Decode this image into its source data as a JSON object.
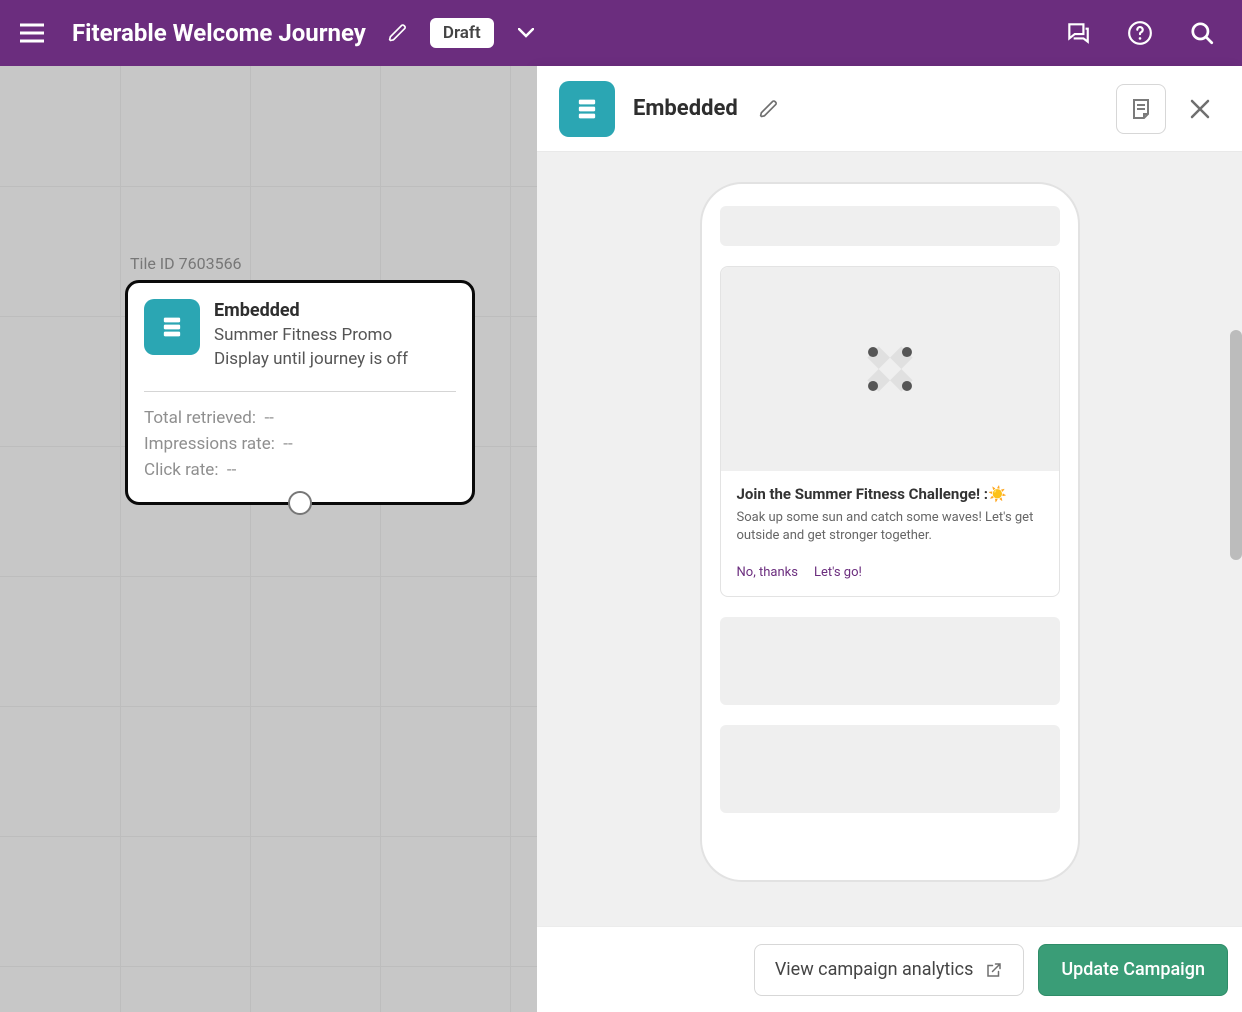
{
  "header": {
    "journey_title": "Fiterable Welcome Journey",
    "status": "Draft"
  },
  "canvas": {
    "tile_id_label": "Tile ID 7603566",
    "tile": {
      "type_label": "Embedded",
      "name": "Summer Fitness Promo",
      "display_rule": "Display until journey is off",
      "stats": {
        "total_retrieved": {
          "label": "Total retrieved:",
          "value": "--"
        },
        "impressions_rate": {
          "label": "Impressions rate:",
          "value": "--"
        },
        "click_rate": {
          "label": "Click rate:",
          "value": "--"
        }
      }
    }
  },
  "panel": {
    "title": "Embedded",
    "preview": {
      "card": {
        "title": "Join the Summer Fitness Challenge! :☀️",
        "body": "Soak up some sun and catch some waves! Let's get outside and get stronger together.",
        "action_secondary": "No, thanks",
        "action_primary": "Let's go!"
      }
    },
    "footer": {
      "view_analytics_label": "View campaign analytics",
      "update_label": "Update Campaign"
    }
  }
}
